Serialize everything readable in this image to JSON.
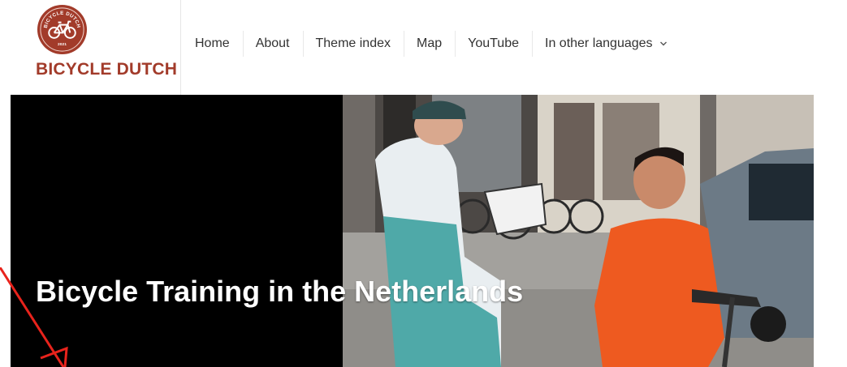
{
  "site": {
    "logo_text": "BICYCLE DUTCH",
    "logo_badge_text": "BICYCLE DUTCH",
    "logo_badge_year": "2021",
    "brand_color": "#a23b2a"
  },
  "nav": {
    "items": [
      {
        "label": "Home"
      },
      {
        "label": "About"
      },
      {
        "label": "Theme index"
      },
      {
        "label": "Map"
      },
      {
        "label": "YouTube"
      },
      {
        "label": "In other languages",
        "has_dropdown": true,
        "icon": "chevron-down-icon"
      }
    ]
  },
  "hero": {
    "title": "Bicycle Training in the Netherlands",
    "background": "#000000",
    "photo_icon": "photo-illustration"
  },
  "annotation": {
    "color": "#e8231c",
    "icon": "red-arrow-annotation"
  }
}
